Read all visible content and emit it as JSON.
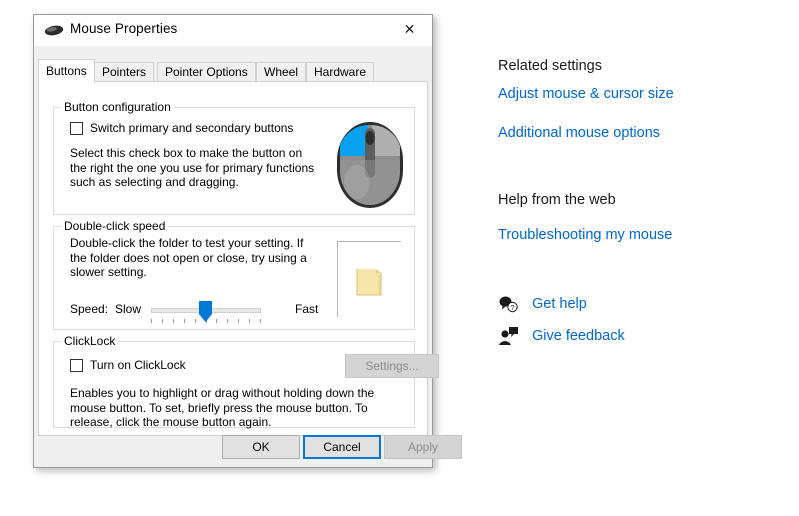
{
  "window": {
    "title": "Mouse Properties",
    "icon": "mouse-icon",
    "close_label": "✕"
  },
  "tabs": [
    {
      "label": "Buttons",
      "active": true
    },
    {
      "label": "Pointers",
      "active": false
    },
    {
      "label": "Pointer Options",
      "active": false
    },
    {
      "label": "Wheel",
      "active": false
    },
    {
      "label": "Hardware",
      "active": false
    }
  ],
  "button_configuration": {
    "legend": "Button configuration",
    "checkbox_label": "Switch primary and secondary buttons",
    "checkbox_checked": false,
    "description": "Select this check box to make the button on the right the one you use for primary functions such as selecting and dragging.",
    "illustration": "mouse-illustration",
    "highlight_color": "#0aa2f0"
  },
  "double_click_speed": {
    "legend": "Double-click speed",
    "description": "Double-click the folder to test your setting. If the folder does not open or close, try using a slower setting.",
    "speed_label": "Speed:",
    "slow_label": "Slow",
    "fast_label": "Fast",
    "slider_value": 6,
    "slider_min": 1,
    "slider_max": 11,
    "tick_count": 11,
    "test_icon": "folder-icon"
  },
  "click_lock": {
    "legend": "ClickLock",
    "checkbox_label": "Turn on ClickLock",
    "checkbox_checked": false,
    "settings_button_label": "Settings...",
    "settings_button_enabled": false,
    "description": "Enables you to highlight or drag without holding down the mouse button. To set, briefly press the mouse button. To release, click the mouse button again."
  },
  "dialog_buttons": {
    "ok": "OK",
    "cancel": "Cancel",
    "apply": "Apply",
    "focused": "Cancel",
    "apply_enabled": false
  },
  "side_panel": {
    "related_settings_heading": "Related settings",
    "links": [
      {
        "label": "Adjust mouse & cursor size"
      },
      {
        "label": "Additional mouse options"
      }
    ],
    "help_heading": "Help from the web",
    "help_links": [
      {
        "label": "Troubleshooting my mouse"
      }
    ],
    "help_rows": [
      {
        "label": "Get help",
        "icon": "question-bubble-icon"
      },
      {
        "label": "Give feedback",
        "icon": "person-feedback-icon"
      }
    ],
    "link_color": "#0066cc"
  }
}
